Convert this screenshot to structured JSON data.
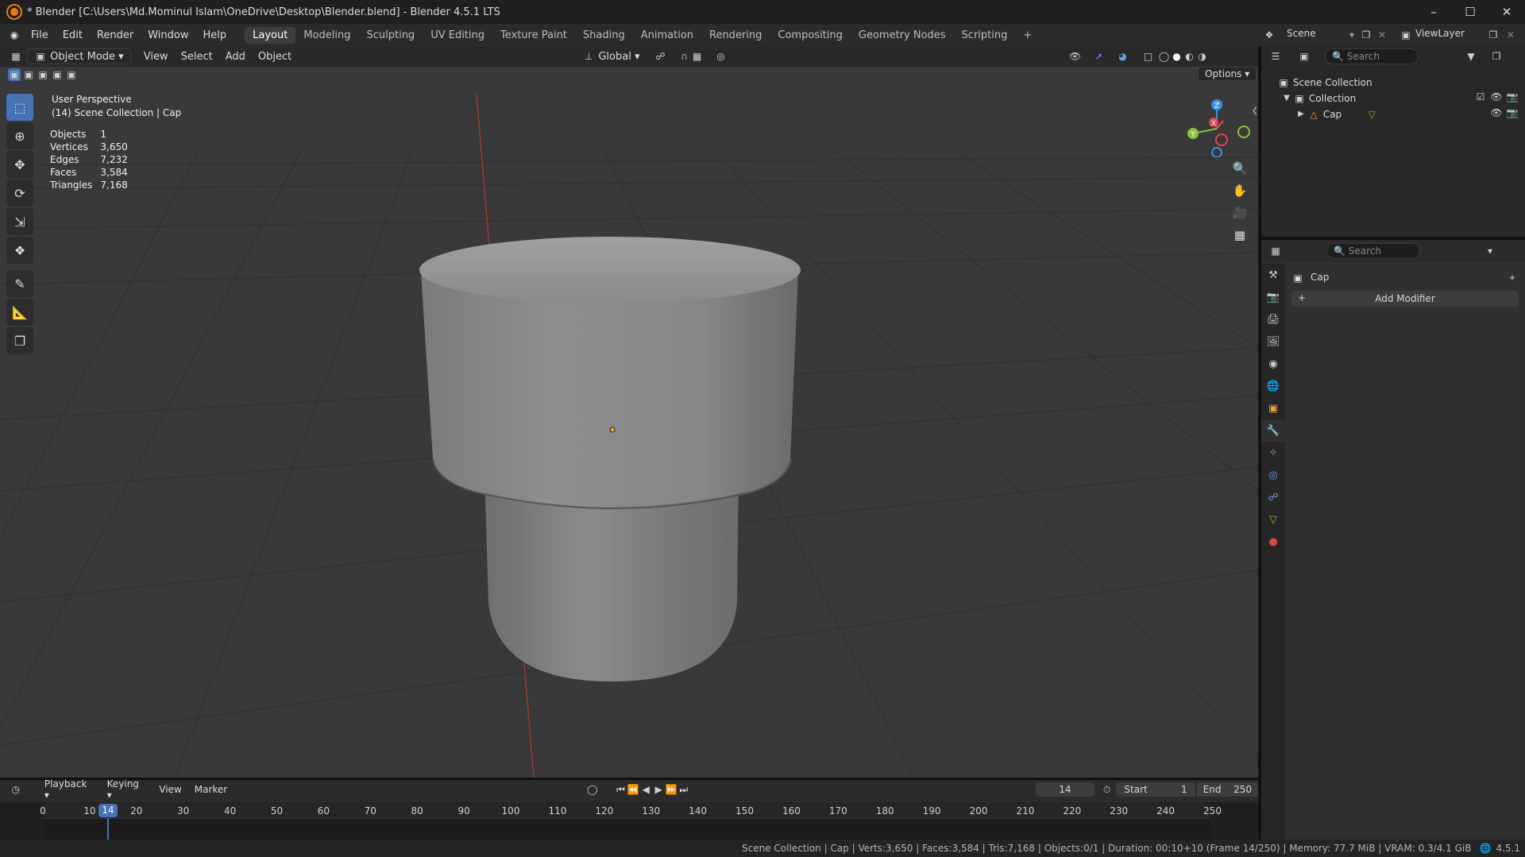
{
  "window": {
    "title": "* Blender [C:\\Users\\Md.Mominul Islam\\OneDrive\\Desktop\\Blender.blend] - Blender 4.5.1 LTS",
    "controls": [
      "–",
      "☐",
      "✕"
    ]
  },
  "menubar": {
    "menus": [
      "File",
      "Edit",
      "Render",
      "Window",
      "Help"
    ],
    "workspaces": [
      "Layout",
      "Modeling",
      "Sculpting",
      "UV Editing",
      "Texture Paint",
      "Shading",
      "Animation",
      "Rendering",
      "Compositing",
      "Geometry Nodes",
      "Scripting"
    ],
    "active_workspace": "Layout",
    "add_workspace": "+",
    "scene": "Scene",
    "view_layer": "ViewLayer"
  },
  "viewport_header": {
    "mode": "Object Mode",
    "menus": [
      "View",
      "Select",
      "Add",
      "Object"
    ],
    "transform_orientation": "Global"
  },
  "viewport": {
    "options_label": "Options",
    "perspective": "User Perspective",
    "context": "(14) Scene Collection | Cap",
    "stats": [
      {
        "label": "Objects",
        "value": "1"
      },
      {
        "label": "Vertices",
        "value": "3,650"
      },
      {
        "label": "Edges",
        "value": "7,232"
      },
      {
        "label": "Faces",
        "value": "3,584"
      },
      {
        "label": "Triangles",
        "value": "7,168"
      }
    ],
    "gizmo_axes": {
      "z": "Z",
      "y": "Y",
      "x": "X"
    },
    "colors": {
      "x": "#e0444b",
      "y": "#89c53c",
      "z": "#3b8fe0",
      "origin": "#f5a623"
    }
  },
  "outliner": {
    "search_placeholder": "Search",
    "root": "Scene Collection",
    "collection": "Collection",
    "object": "Cap"
  },
  "properties": {
    "search_placeholder": "Search",
    "object_name": "Cap",
    "add_modifier": "Add Modifier"
  },
  "timeline": {
    "menus": [
      "Playback",
      "Keying",
      "View",
      "Marker"
    ],
    "current_frame": "14",
    "start_label": "Start",
    "start": "1",
    "end_label": "End",
    "end": "250",
    "ticks": [
      "0",
      "10",
      "20",
      "30",
      "40",
      "50",
      "60",
      "70",
      "80",
      "90",
      "100",
      "110",
      "120",
      "130",
      "140",
      "150",
      "160",
      "170",
      "180",
      "190",
      "200",
      "210",
      "220",
      "230",
      "240",
      "250"
    ],
    "playhead": "14"
  },
  "statusbar": {
    "text": "Scene Collection | Cap | Verts:3,650 | Faces:3,584 | Tris:7,168 | Objects:0/1 | Duration: 00:10+10 (Frame 14/250) | Memory: 77.7 MiB | VRAM: 0.3/4.1 GiB",
    "version": "4.5.1"
  }
}
